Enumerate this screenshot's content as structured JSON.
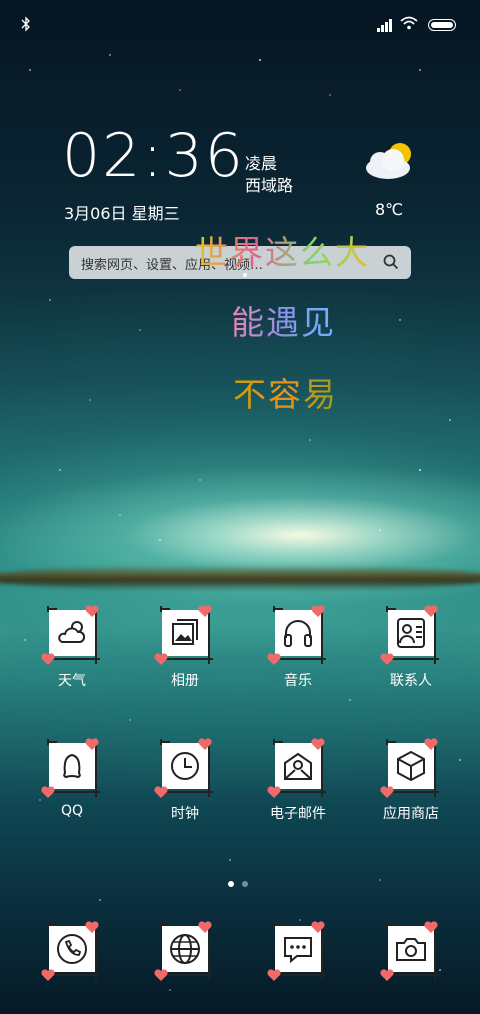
{
  "status_bar": {
    "bluetooth": "bluetooth-icon",
    "signal": "signal-icon",
    "wifi": "wifi-icon",
    "battery": "battery-icon"
  },
  "clock_widget": {
    "time": "02:36",
    "period": "凌晨",
    "location": "西域路",
    "date": "3月06日 星期三",
    "temperature": "8℃",
    "weather_icon": "partly-cloudy-icon"
  },
  "search": {
    "placeholder": "搜索网页、设置、应用、视频…"
  },
  "art_text": {
    "line1": "世界这么大",
    "line2": "能遇见",
    "line3": "不容易"
  },
  "apps_row1": [
    {
      "label": "天气",
      "icon": "weather-icon"
    },
    {
      "label": "相册",
      "icon": "gallery-icon"
    },
    {
      "label": "音乐",
      "icon": "headphones-icon"
    },
    {
      "label": "联系人",
      "icon": "contacts-icon"
    }
  ],
  "apps_row2": [
    {
      "label": "QQ",
      "icon": "qq-icon"
    },
    {
      "label": "时钟",
      "icon": "clock-icon"
    },
    {
      "label": "电子邮件",
      "icon": "mail-icon"
    },
    {
      "label": "应用商店",
      "icon": "app-store-icon"
    }
  ],
  "dock": [
    {
      "icon": "phone-icon"
    },
    {
      "icon": "browser-icon"
    },
    {
      "icon": "messages-icon"
    },
    {
      "icon": "camera-icon"
    }
  ],
  "page_indicator": {
    "pages": 2,
    "active": 0
  },
  "colors": {
    "heart": "#f06a6a",
    "tile": "#ffffff"
  }
}
